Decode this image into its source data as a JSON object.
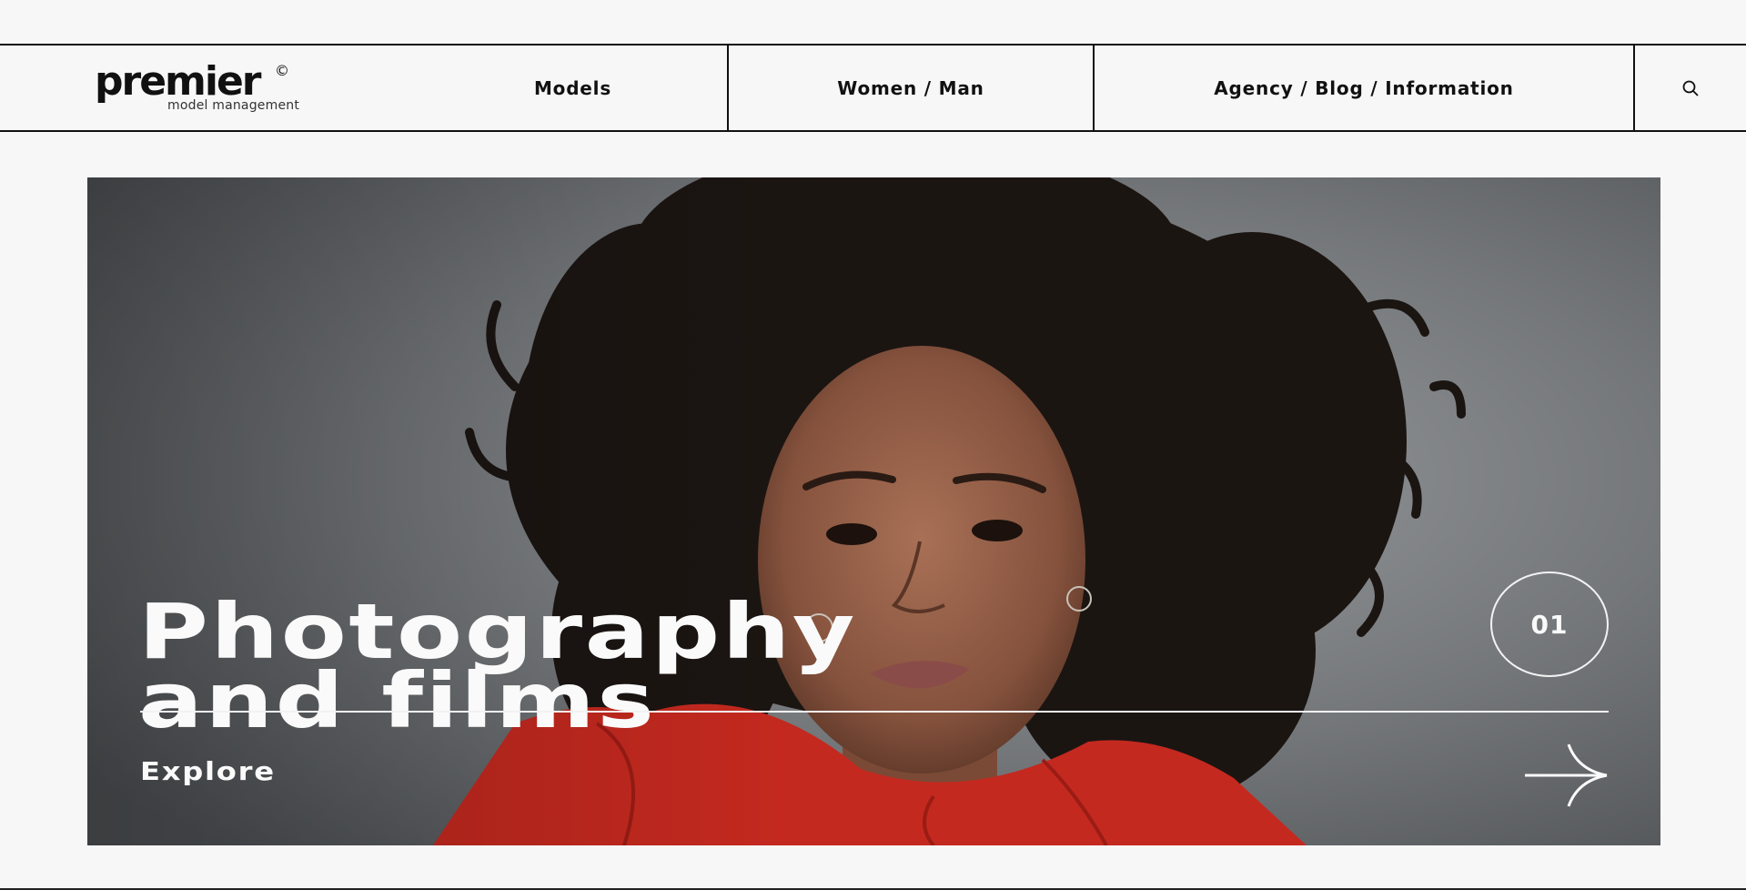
{
  "header": {
    "logo_word": "premier",
    "logo_mark": "©",
    "logo_sub": "model management",
    "nav": [
      {
        "label": "Models"
      },
      {
        "label": "Women / Man"
      },
      {
        "label": "Agency / Blog / Information"
      }
    ],
    "search_icon": "search-icon"
  },
  "hero": {
    "title_line1": "Photography",
    "title_line2": "and films",
    "slide_number": "01",
    "cta_label": "Explore",
    "cta_icon": "arrow-right-icon"
  },
  "colors": {
    "background": "#f7f7f7",
    "text": "#111111",
    "hero_text": "#fafafa",
    "garment": "#c4291f"
  }
}
